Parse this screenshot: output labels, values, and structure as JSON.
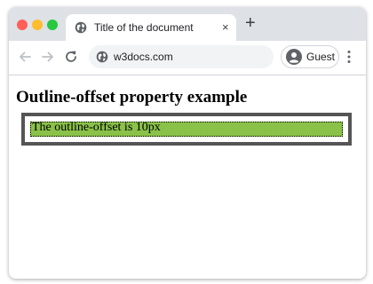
{
  "browser": {
    "tab": {
      "title": "Title of the document",
      "close_glyph": "×"
    },
    "new_tab_glyph": "+",
    "address_bar": {
      "url": "w3docs.com"
    },
    "profile": {
      "label": "Guest"
    },
    "icons": {
      "back": "arrow-left-icon",
      "forward": "arrow-right-icon",
      "reload": "reload-icon",
      "site": "globe-icon",
      "profile": "user-avatar-icon",
      "menu": "kebab-menu-icon"
    },
    "colors": {
      "tabbar": "#dee1e6",
      "close": "#ff5f57",
      "minimize": "#febc2e",
      "maximize": "#28c840"
    }
  },
  "page": {
    "heading": "Outline-offset property example",
    "demo_text": "The outline-offset is 10px",
    "colors": {
      "demo_background": "#8ac249",
      "outline": "#555555"
    }
  }
}
